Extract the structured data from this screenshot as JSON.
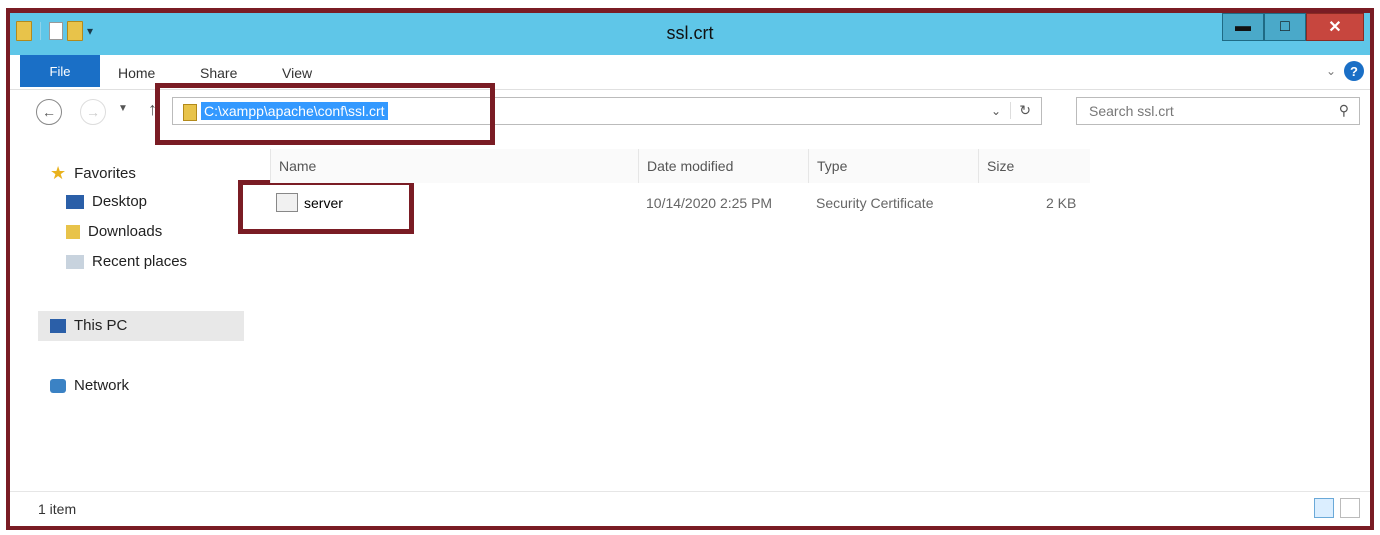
{
  "window": {
    "title": "ssl.crt"
  },
  "ribbon": {
    "file": "File",
    "tabs": [
      "Home",
      "Share",
      "View"
    ]
  },
  "address": {
    "path": "C:\\xampp\\apache\\conf\\ssl.crt"
  },
  "search": {
    "placeholder": "Search ssl.crt"
  },
  "nav": {
    "favorites": "Favorites",
    "items": [
      "Desktop",
      "Downloads",
      "Recent places"
    ],
    "this_pc": "This PC",
    "network": "Network"
  },
  "columns": [
    "Name",
    "Date modified",
    "Type",
    "Size"
  ],
  "files": [
    {
      "name": "server",
      "date": "10/14/2020 2:25 PM",
      "type": "Security Certificate",
      "size": "2 KB"
    }
  ],
  "status": {
    "count": "1 item"
  },
  "colors": {
    "titlebar": "#5fc6e8",
    "file_tab": "#1a6fc6",
    "highlight_border": "#7a1c24",
    "selection": "#3399ff"
  }
}
